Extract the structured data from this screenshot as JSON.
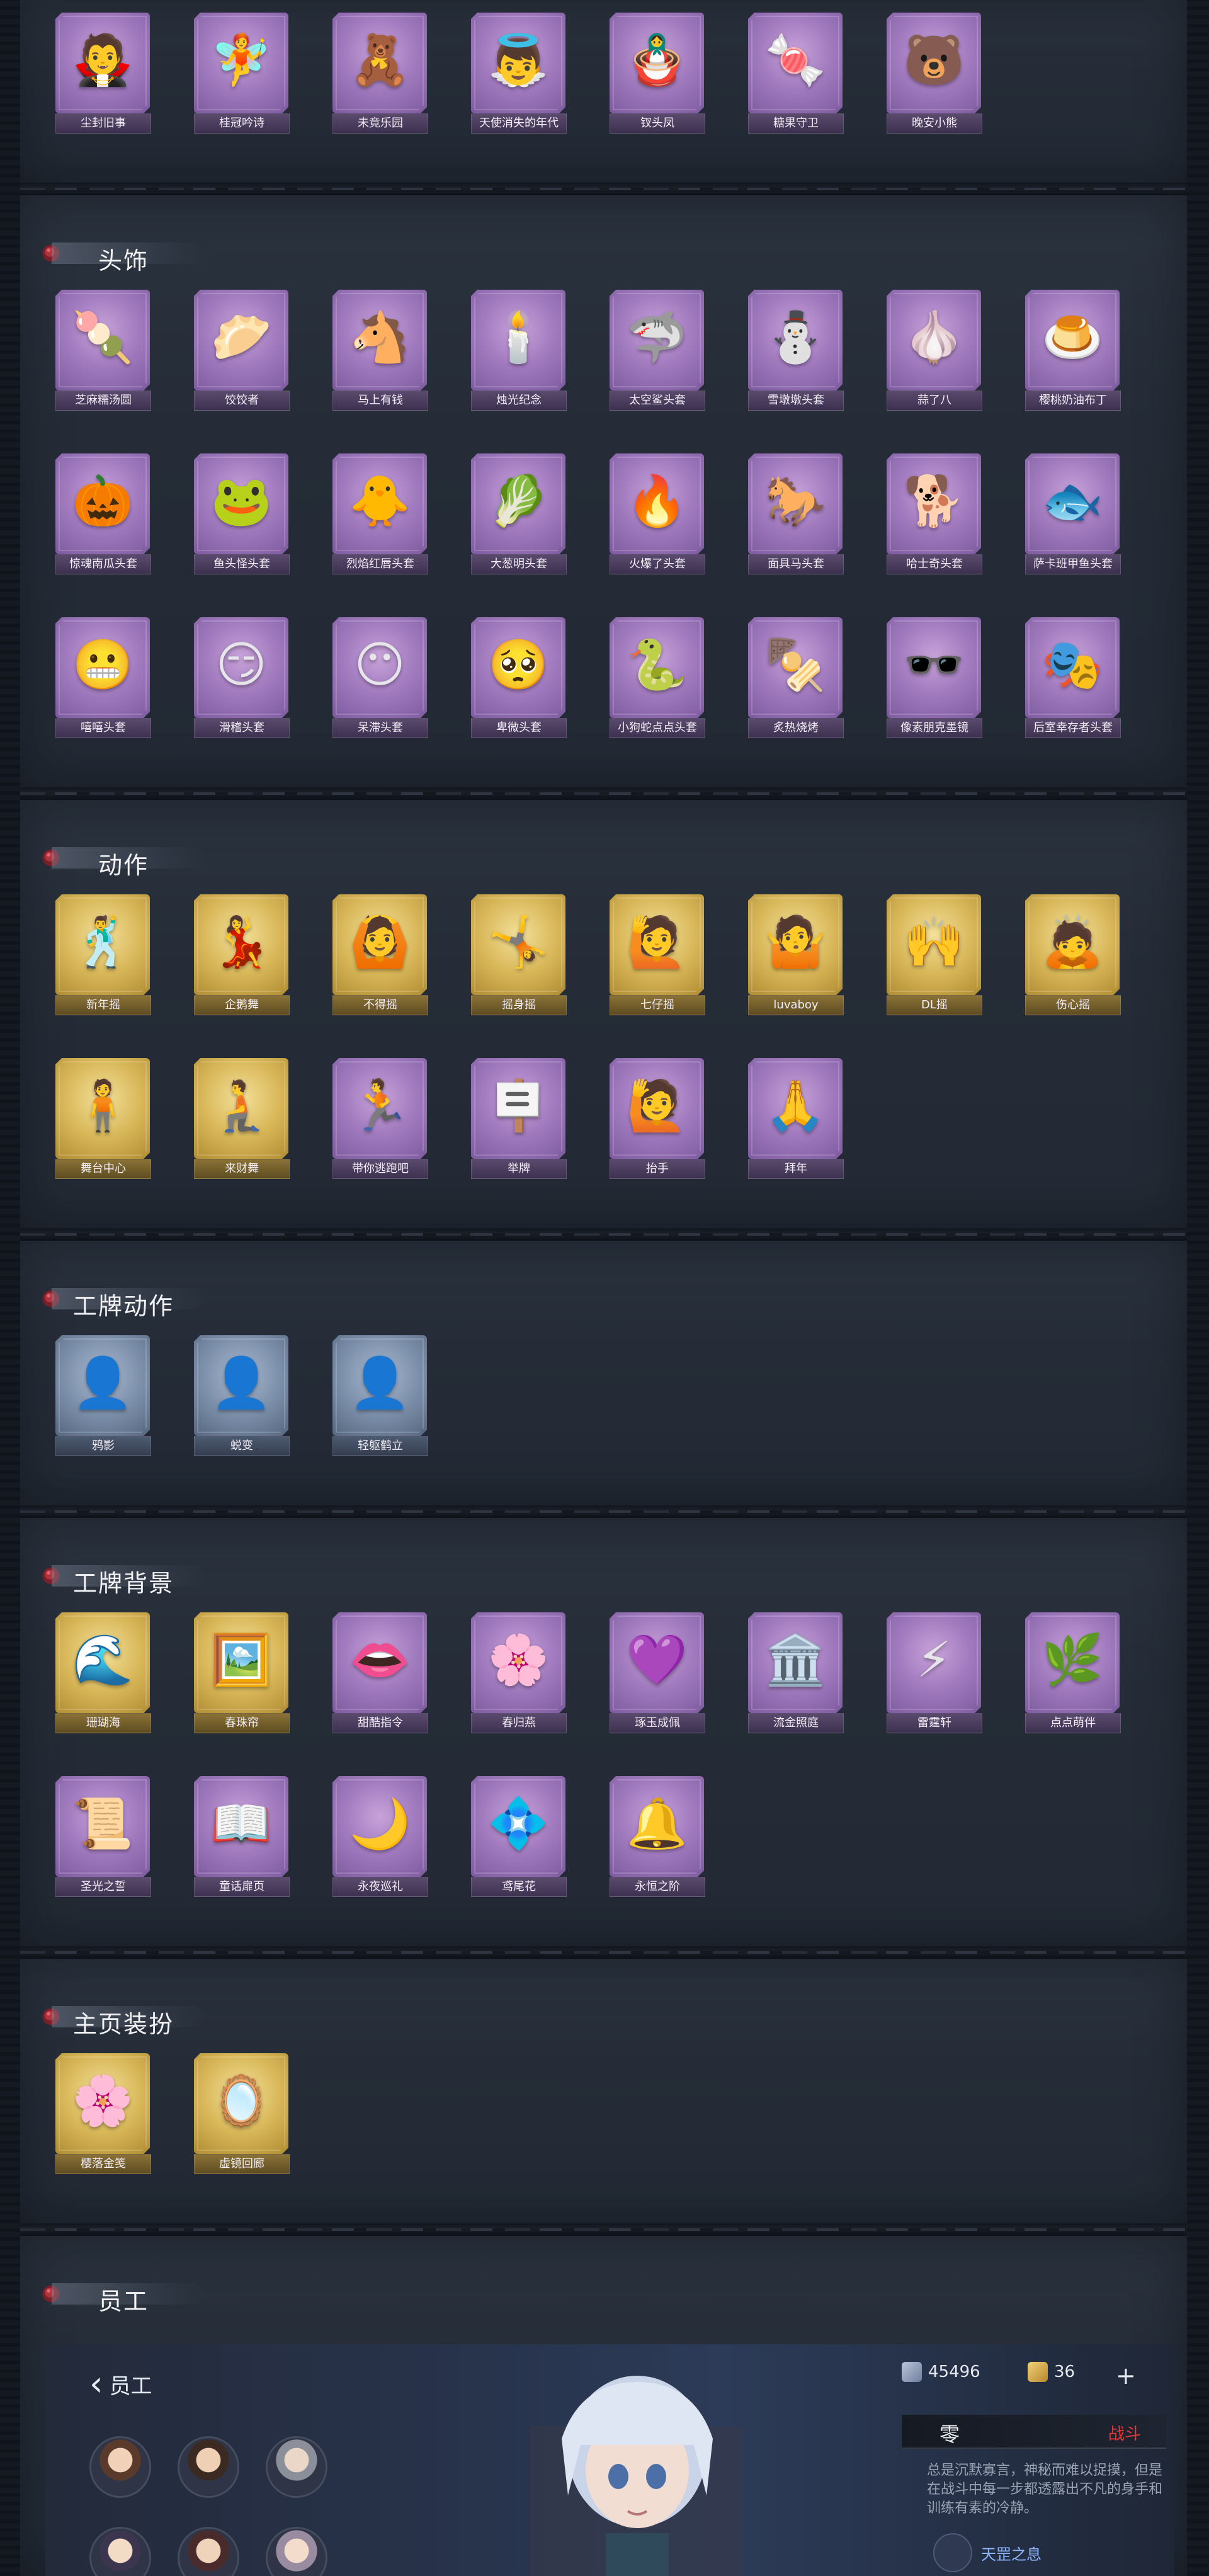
{
  "top_items": [
    {
      "label": "尘封旧事",
      "icon": "🧛",
      "style": "purple"
    },
    {
      "label": "桂冠吟诗",
      "icon": "🧚",
      "style": "purple"
    },
    {
      "label": "未竟乐园",
      "icon": "🧸",
      "style": "purple"
    },
    {
      "label": "天使消失的年代",
      "icon": "👼",
      "style": "purple"
    },
    {
      "label": "钗头凤",
      "icon": "🪆",
      "style": "purple"
    },
    {
      "label": "糖果守卫",
      "icon": "🍬",
      "style": "purple"
    },
    {
      "label": "晚安小熊",
      "icon": "🐻",
      "style": "purple"
    }
  ],
  "sections": {
    "headwear": {
      "title": "头饰",
      "items": [
        {
          "label": "芝麻糯汤圆",
          "icon": "🍡"
        },
        {
          "label": "饺饺者",
          "icon": "🥟"
        },
        {
          "label": "马上有钱",
          "icon": "🐴"
        },
        {
          "label": "烛光纪念",
          "icon": "🕯️"
        },
        {
          "label": "太空鲨头套",
          "icon": "🦈"
        },
        {
          "label": "雪墩墩头套",
          "icon": "⛄"
        },
        {
          "label": "蒜了八",
          "icon": "🧄"
        },
        {
          "label": "樱桃奶油布丁",
          "icon": "🍮"
        },
        {
          "label": "惊魂南瓜头套",
          "icon": "🎃"
        },
        {
          "label": "鱼头怪头套",
          "icon": "🐸"
        },
        {
          "label": "烈焰红唇头套",
          "icon": "🐥"
        },
        {
          "label": "大葱明头套",
          "icon": "🥬"
        },
        {
          "label": "火爆了头套",
          "icon": "🔥"
        },
        {
          "label": "面具马头套",
          "icon": "🐎"
        },
        {
          "label": "哈士奇头套",
          "icon": "🐕"
        },
        {
          "label": "萨卡班甲鱼头套",
          "icon": "🐟"
        },
        {
          "label": "嘻嘻头套",
          "icon": "😬"
        },
        {
          "label": "滑稽头套",
          "icon": "😏"
        },
        {
          "label": "呆滞头套",
          "icon": "😶"
        },
        {
          "label": "卑微头套",
          "icon": "🥺"
        },
        {
          "label": "小狗蛇点点头套",
          "icon": "🐍"
        },
        {
          "label": "炙热烧烤",
          "icon": "🍢"
        },
        {
          "label": "像素朋克墨镜",
          "icon": "🕶️"
        },
        {
          "label": "后室幸存者头套",
          "icon": "🎭"
        }
      ]
    },
    "actions": {
      "title": "动作",
      "items": [
        {
          "label": "新年摇",
          "icon": "🕺",
          "style": "gold"
        },
        {
          "label": "企鹅舞",
          "icon": "💃",
          "style": "gold"
        },
        {
          "label": "不得摇",
          "icon": "🙆",
          "style": "gold"
        },
        {
          "label": "摇身摇",
          "icon": "🤸",
          "style": "gold"
        },
        {
          "label": "七仔摇",
          "icon": "🙋",
          "style": "gold"
        },
        {
          "label": "luvaboy",
          "icon": "🤷",
          "style": "gold"
        },
        {
          "label": "DL摇",
          "icon": "🙌",
          "style": "gold"
        },
        {
          "label": "伤心摇",
          "icon": "🙇",
          "style": "gold"
        },
        {
          "label": "舞台中心",
          "icon": "🧍",
          "style": "gold"
        },
        {
          "label": "来财舞",
          "icon": "🧎",
          "style": "gold"
        },
        {
          "label": "带你逃跑吧",
          "icon": "🏃",
          "style": "purple"
        },
        {
          "label": "举牌",
          "icon": "🪧",
          "style": "purple"
        },
        {
          "label": "抬手",
          "icon": "🙋",
          "style": "purple"
        },
        {
          "label": "拜年",
          "icon": "🙏",
          "style": "purple"
        }
      ]
    },
    "badge_actions": {
      "title": "工牌动作",
      "items": [
        {
          "label": "鸦影",
          "icon": "👤",
          "style": "steel"
        },
        {
          "label": "蜕变",
          "icon": "👤",
          "style": "steel"
        },
        {
          "label": "轻躯鹤立",
          "icon": "👤",
          "style": "steel"
        }
      ]
    },
    "badge_backgrounds": {
      "title": "工牌背景",
      "items": [
        {
          "label": "珊瑚海",
          "icon": "🌊",
          "style": "gold"
        },
        {
          "label": "春珠帘",
          "icon": "🖼️",
          "style": "gold"
        },
        {
          "label": "甜酷指令",
          "icon": "👄",
          "style": "purple"
        },
        {
          "label": "春归燕",
          "icon": "🌸",
          "style": "purple"
        },
        {
          "label": "琢玉成佩",
          "icon": "💜",
          "style": "purple"
        },
        {
          "label": "流金照庭",
          "icon": "🏛️",
          "style": "purple"
        },
        {
          "label": "雷霆轩",
          "icon": "⚡",
          "style": "purple"
        },
        {
          "label": "点点萌伴",
          "icon": "🌿",
          "style": "purple"
        },
        {
          "label": "圣光之誓",
          "icon": "📜",
          "style": "purple"
        },
        {
          "label": "童话扉页",
          "icon": "📖",
          "style": "purple"
        },
        {
          "label": "永夜巡礼",
          "icon": "🌙",
          "style": "purple"
        },
        {
          "label": "鸢尾花",
          "icon": "💠",
          "style": "purple"
        },
        {
          "label": "永恒之阶",
          "icon": "🔔",
          "style": "purple"
        }
      ]
    },
    "home_decor": {
      "title": "主页装扮",
      "items": [
        {
          "label": "樱落金笺",
          "icon": "🌸",
          "style": "gold"
        },
        {
          "label": "虚镜回廊",
          "icon": "🪞",
          "style": "gold"
        }
      ]
    },
    "employee": {
      "title": "员工"
    }
  },
  "employee_screen": {
    "back_label": "员工",
    "currency_1": "45496",
    "currency_2": "36",
    "add_symbol": "+",
    "name": "零",
    "role": "战斗",
    "description": "总是沉默寡言，神秘而难以捉摸，但是在战斗中每一步都透露出不凡的身手和训练有素的冷静。",
    "skill_name": "天罡之息"
  },
  "colors": {
    "background": "#1c222c",
    "card_purple": "#a37cc0",
    "card_gold": "#d9b85a",
    "card_steel": "#7d90ab",
    "role_red": "#e33a3a"
  }
}
